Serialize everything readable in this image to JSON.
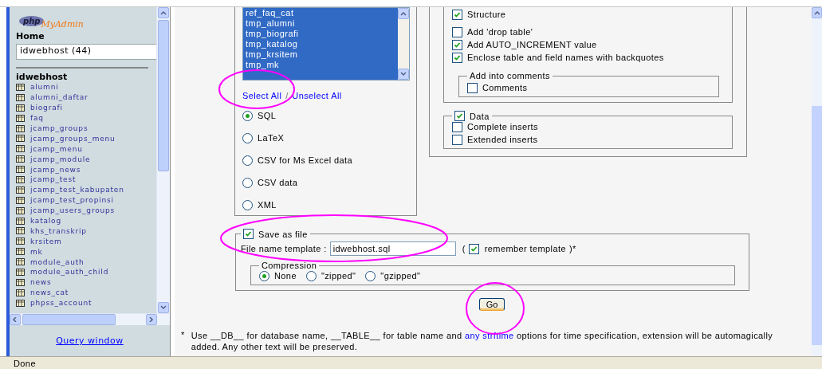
{
  "sidebar": {
    "logo": {
      "php": "php",
      "name": "MyAdmin"
    },
    "home": "Home",
    "database_select": {
      "value": "idwebhost (44)"
    },
    "database_name": "idwebhost",
    "tables": [
      "alumni",
      "alumni_daftar",
      "biografi",
      "faq",
      "jcamp_groups",
      "jcamp_groups_menu",
      "jcamp_menu",
      "jcamp_module",
      "jcamp_news",
      "jcamp_test",
      "jcamp_test_kabupaten",
      "jcamp_test_propinsi",
      "jcamp_users_groups",
      "katalog",
      "khs_transkrip",
      "krsitem",
      "mk",
      "module_auth",
      "module_auth_child",
      "news",
      "news_cat",
      "phpss_account"
    ],
    "query_window": "Query window"
  },
  "export": {
    "table_list": [
      {
        "label": "ref_faq_cat",
        "selected": true
      },
      {
        "label": "tmp_alumni",
        "selected": true
      },
      {
        "label": "tmp_biografi",
        "selected": true
      },
      {
        "label": "tmp_katalog",
        "selected": true
      },
      {
        "label": "tmp_krsitem",
        "selected": true
      },
      {
        "label": "tmp_mk",
        "selected": true
      }
    ],
    "select_all": "Select All",
    "separator": "/",
    "unselect_all": "Unselect All",
    "formats": [
      {
        "label": "SQL",
        "selected": true
      },
      {
        "label": "LaTeX",
        "selected": false
      },
      {
        "label": "CSV for Ms Excel data",
        "selected": false
      },
      {
        "label": "CSV data",
        "selected": false
      },
      {
        "label": "XML",
        "selected": false
      }
    ],
    "structure": {
      "label": "Structure",
      "checked": true,
      "options": [
        {
          "label": "Add 'drop table'",
          "checked": false
        },
        {
          "label": "Add AUTO_INCREMENT value",
          "checked": true
        },
        {
          "label": "Enclose table and field names with backquotes",
          "checked": true
        }
      ],
      "comments_group": {
        "legend": "Add into comments",
        "options": [
          {
            "label": "Comments",
            "checked": false
          }
        ]
      }
    },
    "data": {
      "label": "Data",
      "checked": true,
      "options": [
        {
          "label": "Complete inserts",
          "checked": false
        },
        {
          "label": "Extended inserts",
          "checked": false
        }
      ]
    },
    "save_as_file": {
      "label": "Save as file",
      "checked": true,
      "template_label": "File name template :",
      "template_value": "idwebhost.sql",
      "open_paren": "(",
      "remember": {
        "label": "remember template",
        "checked": true
      },
      "close_paren": ")*",
      "compression": {
        "legend": "Compression",
        "options": [
          {
            "label": "None",
            "selected": true
          },
          {
            "label": "\"zipped\"",
            "selected": false
          },
          {
            "label": "\"gzipped\"",
            "selected": false
          }
        ]
      }
    },
    "go_button": "Go",
    "footnote": {
      "mark": "*",
      "before": "Use __DB__ for database name, __TABLE__ for table name and ",
      "link": "any strftime",
      "after": " options for time specification, extension will be automagically added. Any other text will be preserved."
    }
  },
  "status_bar": {
    "text": "Done"
  }
}
